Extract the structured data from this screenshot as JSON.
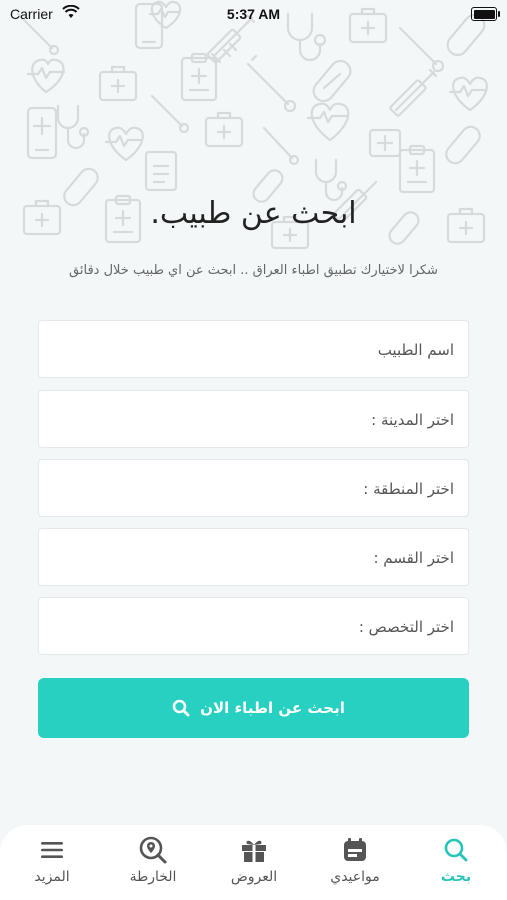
{
  "status_bar": {
    "carrier": "Carrier",
    "time": "5:37 AM"
  },
  "header": {
    "title": "ابحث عن طبيب.",
    "subtitle": "شكرا لاختيارك تطبيق اطباء العراق .. ابحث عن اي طبيب خلال دقائق"
  },
  "form": {
    "doctor_name_placeholder": "اسم الطبيب",
    "city_label": "اختر المدينة :",
    "area_label": "اختر المنطقة :",
    "department_label": "اختر القسم :",
    "specialty_label": "اختر التخصص :",
    "search_button": "ابحث عن اطباء الان"
  },
  "tabbar": {
    "tabs": [
      {
        "label": "بحث",
        "icon": "search-icon",
        "active": true
      },
      {
        "label": "مواعيدي",
        "icon": "calendar-icon",
        "active": false
      },
      {
        "label": "العروض",
        "icon": "gift-icon",
        "active": false
      },
      {
        "label": "الخارطة",
        "icon": "map-search-icon",
        "active": false
      },
      {
        "label": "المزيد",
        "icon": "menu-icon",
        "active": false
      }
    ]
  },
  "colors": {
    "accent": "#27d0c1",
    "background": "#f3f7f8",
    "active_tab": "#27c4b7",
    "pattern": "#d8dcde"
  }
}
